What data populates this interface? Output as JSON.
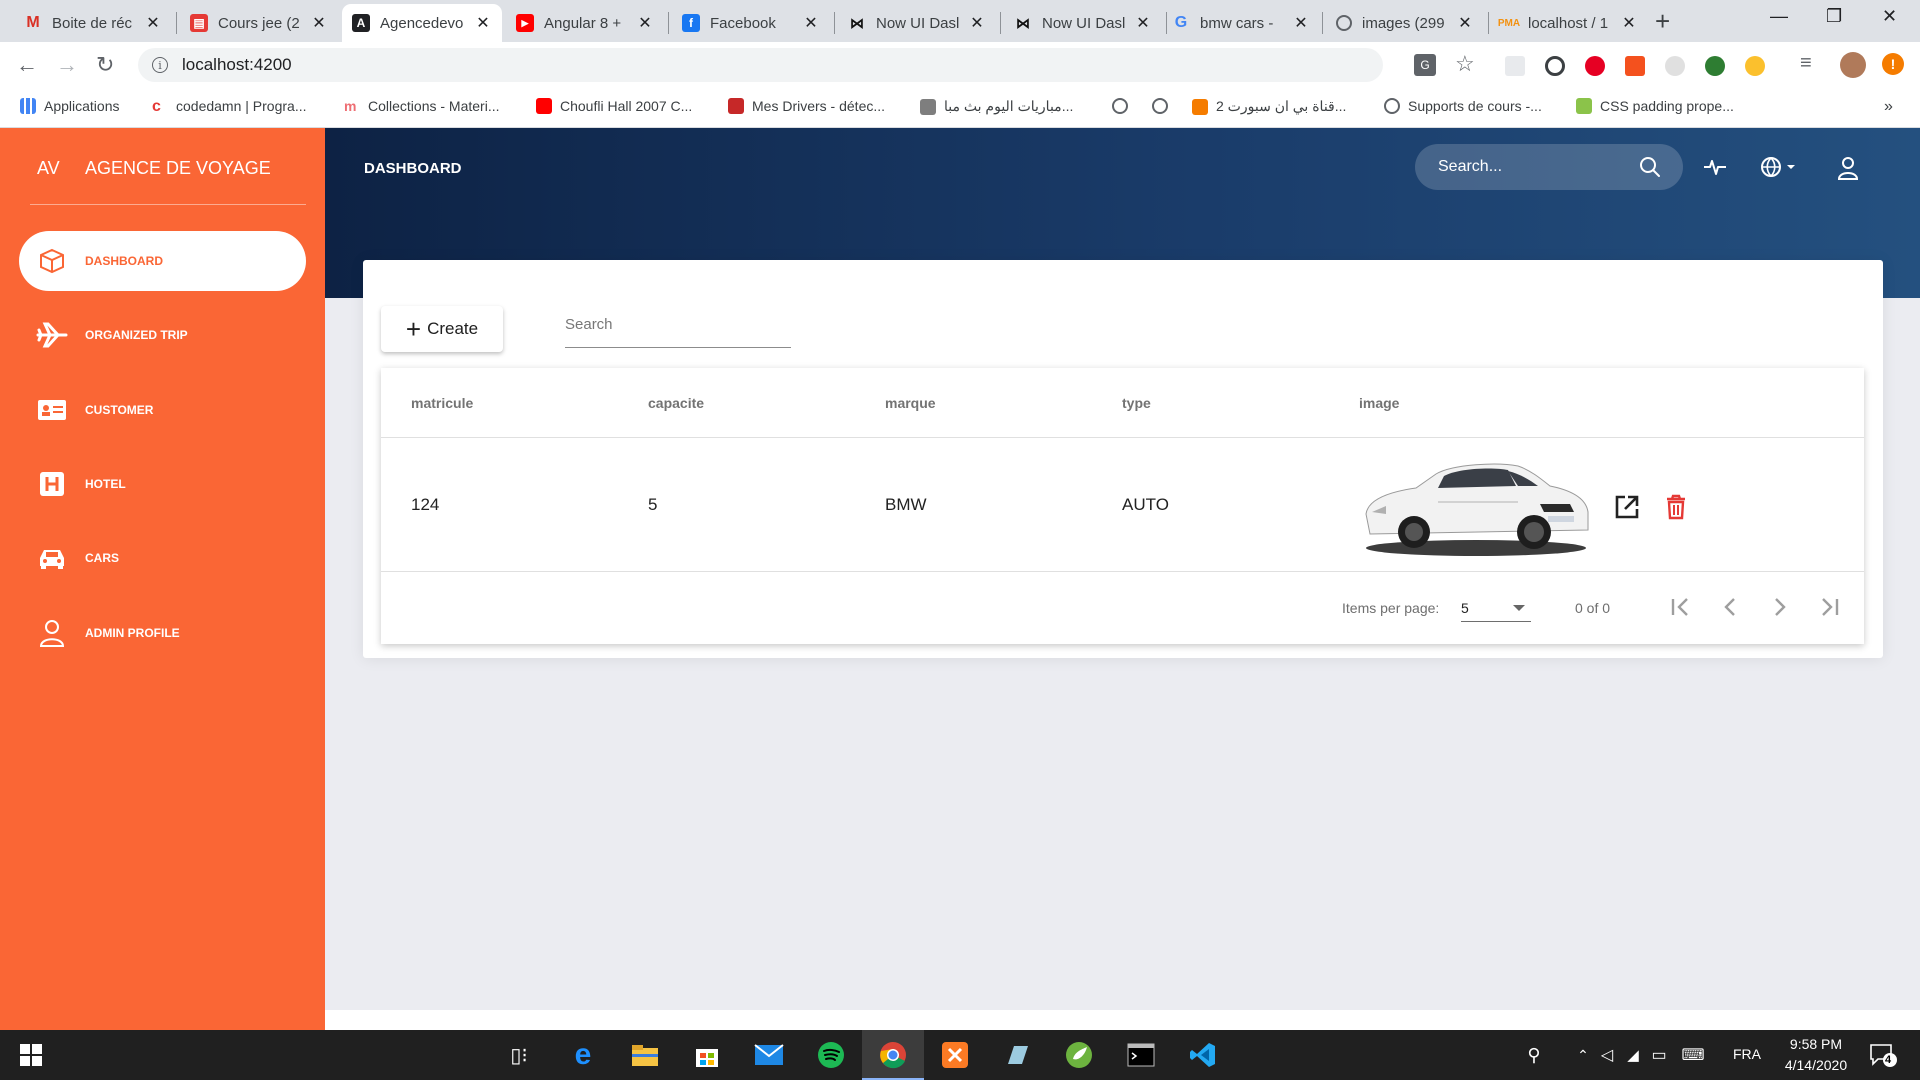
{
  "browser": {
    "tabs": [
      {
        "title": "Boite de réc",
        "icon": "gmail-icon"
      },
      {
        "title": "Cours jee (2",
        "icon": "clapper-icon"
      },
      {
        "title": "Agencedevo",
        "icon": "angular-icon"
      },
      {
        "title": "Angular 8 +",
        "icon": "youtube-icon"
      },
      {
        "title": "Facebook",
        "icon": "facebook-icon"
      },
      {
        "title": "Now UI Dasl",
        "icon": "bowtie-icon"
      },
      {
        "title": "Now UI Dasl",
        "icon": "bowtie-icon"
      },
      {
        "title": "bmw cars - ",
        "icon": "google-icon"
      },
      {
        "title": "images (299",
        "icon": "globe-icon"
      },
      {
        "title": "localhost / 1",
        "icon": "phpmyadmin-icon"
      }
    ],
    "url": "localhost:4200",
    "bookmarks": [
      "Applications",
      "codedamn | Progra...",
      "Collections - Materi...",
      "Choufli Hall 2007 C...",
      "Mes Drivers - détec...",
      "مباريات اليوم بث مبا...",
      "قناة بي ان سبورت 2...",
      "Supports de cours -...",
      "CSS padding prope..."
    ],
    "bookmarks_overflow": "»"
  },
  "sidebar": {
    "logo_mini": "AV",
    "logo_text": "AGENCE DE VOYAGE",
    "items": [
      {
        "label": "DASHBOARD",
        "icon": "box-icon",
        "active": true
      },
      {
        "label": "ORGANIZED TRIP",
        "icon": "airplane-icon",
        "active": false
      },
      {
        "label": "CUSTOMER",
        "icon": "id-card-icon",
        "active": false
      },
      {
        "label": "HOTEL",
        "icon": "hotel-icon",
        "active": false
      },
      {
        "label": "CARS",
        "icon": "car-icon",
        "active": false
      },
      {
        "label": "ADMIN PROFILE",
        "icon": "user-icon",
        "active": false
      }
    ]
  },
  "header": {
    "title": "DASHBOARD",
    "search_placeholder": "Search..."
  },
  "toolbar": {
    "create_label": "Create",
    "search_placeholder": "Search"
  },
  "table": {
    "columns": [
      "matricule",
      "capacite",
      "marque",
      "type",
      "image"
    ],
    "rows": [
      {
        "matricule": "124",
        "capacite": "5",
        "marque": "BMW",
        "type": "AUTO"
      }
    ]
  },
  "paginator": {
    "items_per_page_label": "Items per page:",
    "items_per_page": "5",
    "range": "0 of 0"
  },
  "taskbar": {
    "time": "9:58 PM",
    "date": "4/14/2020",
    "language": "FRA",
    "notifications": "4"
  },
  "colors": {
    "sidebar": "#fa6635",
    "header_dark": "#0d2244",
    "delete": "#e53935"
  }
}
